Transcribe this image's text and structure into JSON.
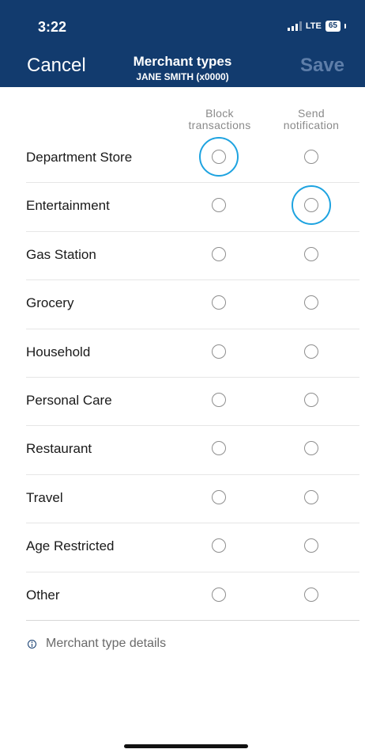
{
  "status_bar": {
    "time": "3:22",
    "network": "LTE",
    "battery": "65"
  },
  "header": {
    "cancel_label": "Cancel",
    "title": "Merchant types",
    "subtitle": "JANE SMITH (x0000)",
    "save_label": "Save"
  },
  "columns": {
    "block": [
      "Block",
      "transactions"
    ],
    "notify": [
      "Send",
      "notification"
    ]
  },
  "rows": [
    {
      "label": "Department Store",
      "block": false,
      "notify": false,
      "highlight": "block"
    },
    {
      "label": "Entertainment",
      "block": false,
      "notify": false,
      "highlight": "notify"
    },
    {
      "label": "Gas Station",
      "block": false,
      "notify": false
    },
    {
      "label": "Grocery",
      "block": false,
      "notify": false
    },
    {
      "label": "Household",
      "block": false,
      "notify": false
    },
    {
      "label": "Personal Care",
      "block": false,
      "notify": false
    },
    {
      "label": "Restaurant",
      "block": false,
      "notify": false
    },
    {
      "label": "Travel",
      "block": false,
      "notify": false
    },
    {
      "label": "Age Restricted",
      "block": false,
      "notify": false
    },
    {
      "label": "Other",
      "block": false,
      "notify": false
    }
  ],
  "details": {
    "icon": "info-icon",
    "label": "Merchant type details"
  },
  "colors": {
    "header_bg": "#123b6e",
    "highlight": "#1ea3e0",
    "save_disabled": "#5e7ea9"
  }
}
